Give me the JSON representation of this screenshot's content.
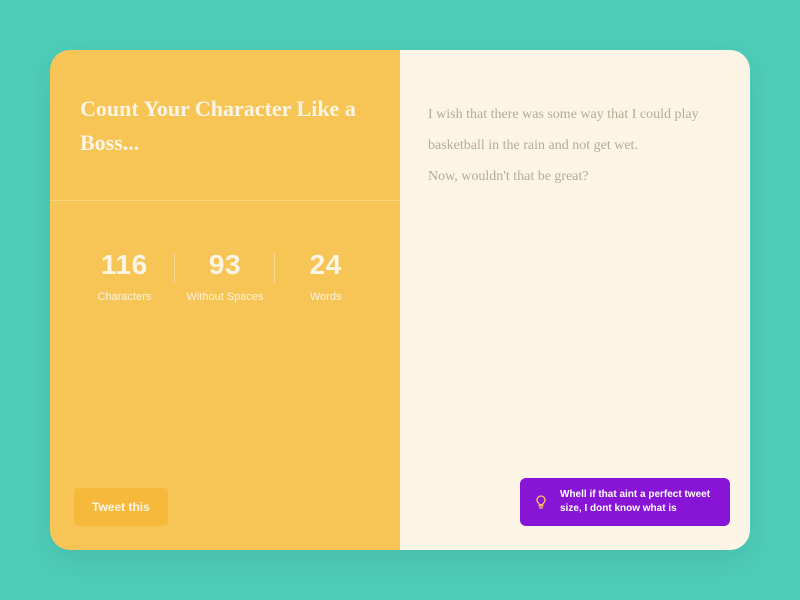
{
  "title": "Count Your Character\nLike a Boss...",
  "stats": {
    "characters": {
      "value": "116",
      "label": "Characters"
    },
    "withoutSpaces": {
      "value": "93",
      "label": "Without Spaces"
    },
    "words": {
      "value": "24",
      "label": "Words"
    }
  },
  "tweetButton": "Tweet this",
  "textContent": "I wish that there was some way that I could play basketball in the rain and not get wet.\nNow, wouldn't that be great?",
  "tip": "Whell if that aint a perfect tweet size, I dont know what is"
}
